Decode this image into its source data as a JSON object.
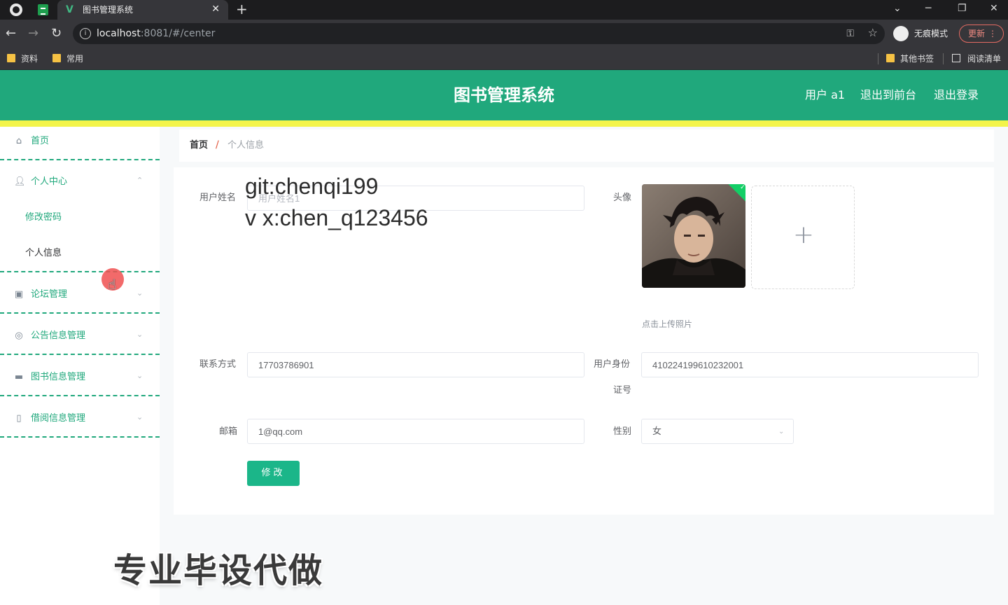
{
  "browser": {
    "tab_title": "图书管理系统",
    "tab_close": "✕",
    "new_tab": "+",
    "url_host": "localhost",
    "url_rest": ":8081/#/center",
    "incognito_label": "无痕模式",
    "update_label": "更新",
    "bookmarks": [
      "资料",
      "常用"
    ],
    "bookmarks_right": [
      "其他书签",
      "阅读清单"
    ]
  },
  "header": {
    "title": "图书管理系统",
    "user_label": "用户 a1",
    "back_front_label": "退出到前台",
    "logout_label": "退出登录",
    "accent_color": "#20a87c",
    "stripe_color": "#f3f44a"
  },
  "sidebar": {
    "home": "首页",
    "personal_center": "个人中心",
    "change_password": "修改密码",
    "personal_info": "个人信息",
    "forum_mgmt": "论坛管理",
    "notice_mgmt": "公告信息管理",
    "book_mgmt": "图书信息管理",
    "borrow_mgmt": "借阅信息管理"
  },
  "breadcrumb": {
    "home": "首页",
    "separator": "/",
    "current": "个人信息"
  },
  "form": {
    "username_label": "用户姓名",
    "username_placeholder": "用户姓名1",
    "avatar_label": "头像",
    "upload_hint": "点击上传照片",
    "phone_label": "联系方式",
    "phone_value": "17703786901",
    "idcard_label_1": "用户身份",
    "idcard_label_2": "证号",
    "idcard_value": "410224199610232001",
    "email_label": "邮箱",
    "email_value": "1@qq.com",
    "gender_label": "性别",
    "gender_value": "女",
    "submit_label": "修改"
  },
  "overlay": {
    "watermark_line1": "git:chenqi199",
    "watermark_line2": "v x:chen_q123456",
    "caption": "专业毕设代做"
  }
}
